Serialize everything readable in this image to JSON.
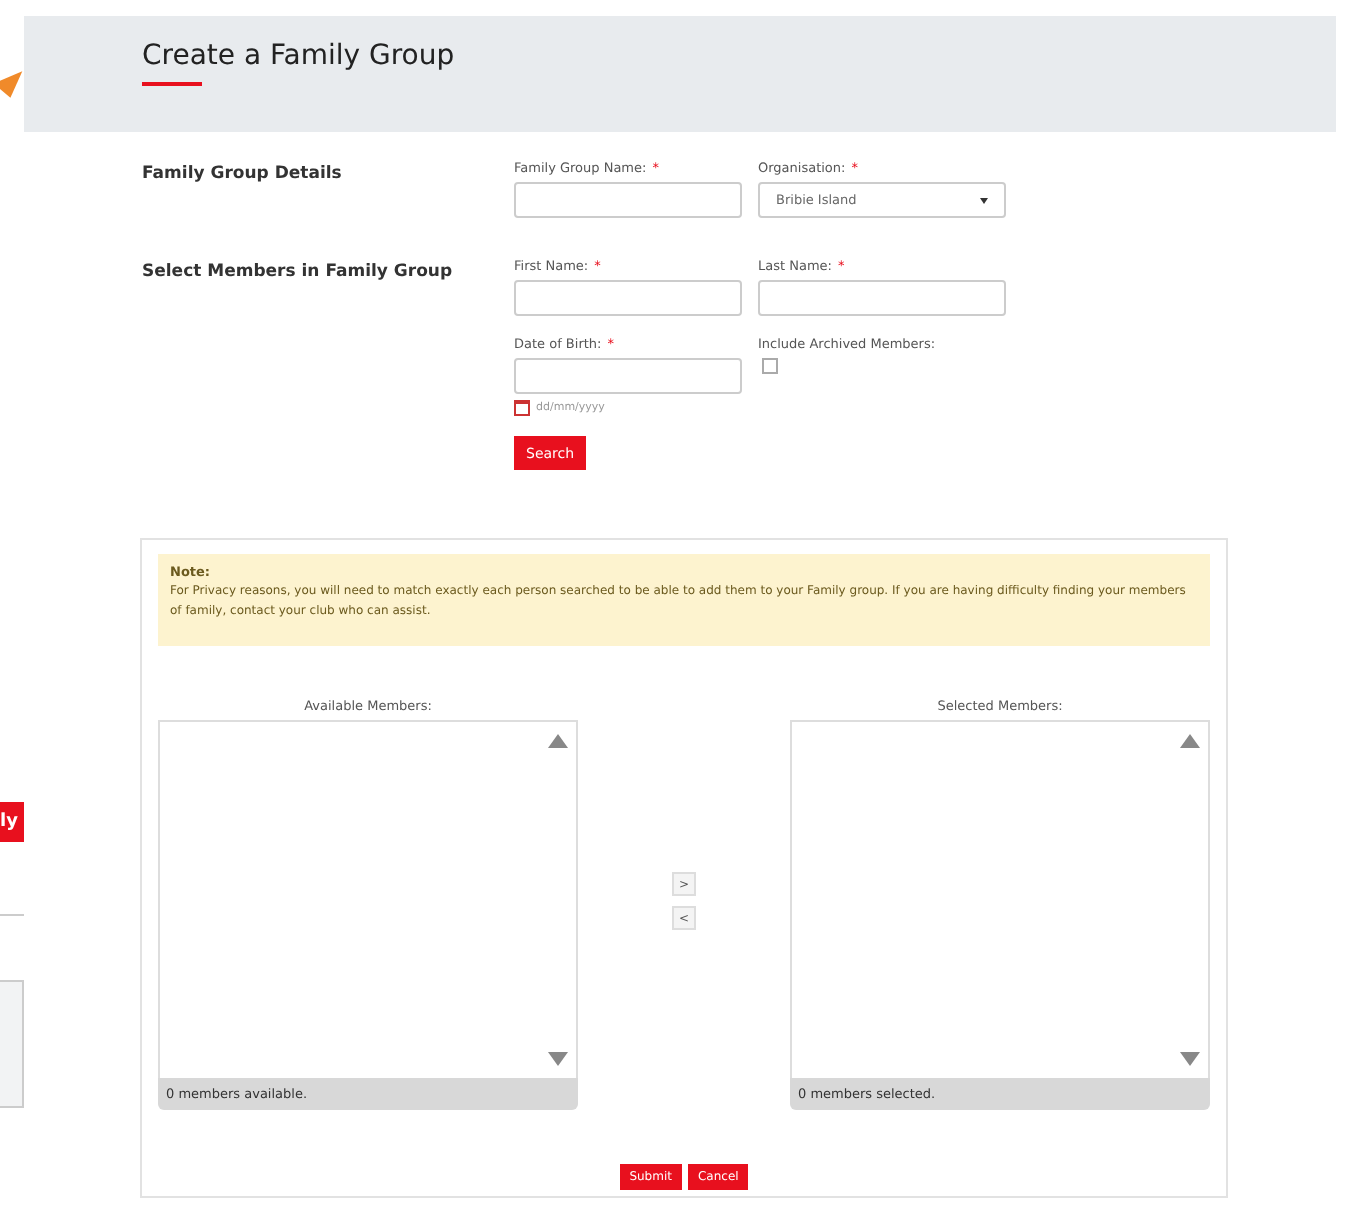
{
  "side_strip": {
    "tab_fragment": "ly"
  },
  "header": {
    "title": "Create a Family Group"
  },
  "sections": [
    {
      "label": "Family Group Details",
      "fields": [
        {
          "kind": "text",
          "label": "Family Group Name:",
          "required_mark": "*"
        },
        {
          "kind": "select",
          "label": "Organisation:",
          "required_mark": "*",
          "value": "Bribie Island"
        }
      ]
    },
    {
      "label": "Select Members in Family Group",
      "fields": [
        {
          "kind": "text",
          "label": "First Name:",
          "required_mark": "*"
        },
        {
          "kind": "text",
          "label": "Last Name:",
          "required_mark": "*"
        },
        {
          "kind": "date",
          "label": "Date of Birth:",
          "required_mark": "*",
          "hint": "dd/mm/yyyy"
        },
        {
          "kind": "checkbox",
          "label": "Include Archived Members:",
          "checked": false
        }
      ]
    }
  ],
  "search_button": "Search",
  "note": {
    "title": "Note:",
    "text": "For Privacy reasons, you will need to match exactly each person searched to be able to add them to your Family group. If you are having difficulty finding your members of family, contact your club who can assist."
  },
  "lists": [
    {
      "label": "Available Members:",
      "footer": "0 members available."
    },
    {
      "label": "Selected Members:",
      "footer": "0 members selected."
    }
  ],
  "move_buttons": [
    ">",
    "<"
  ],
  "actions": [
    "Submit",
    "Cancel"
  ]
}
